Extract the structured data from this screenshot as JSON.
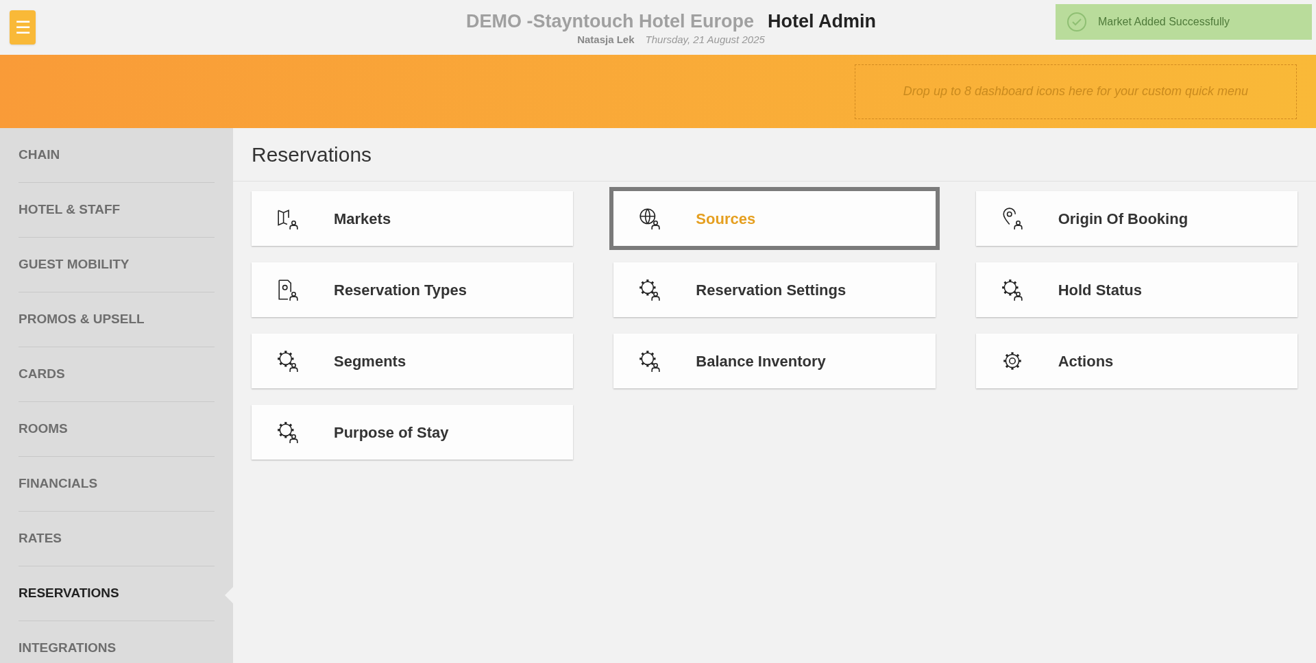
{
  "header": {
    "menu_button": "☰",
    "property": "DEMO -Stayntouch Hotel Europe",
    "app_title": "Hotel Admin",
    "user": "Natasja Lek",
    "date": "Thursday, 21 August 2025"
  },
  "toast": {
    "message": "Market Added Successfully"
  },
  "quick_menu": {
    "placeholder": "Drop up to 8 dashboard icons here for your custom quick menu"
  },
  "sidebar": {
    "items": [
      {
        "label": "CHAIN",
        "selected": false
      },
      {
        "label": "HOTEL & STAFF",
        "selected": false
      },
      {
        "label": "GUEST MOBILITY",
        "selected": false
      },
      {
        "label": "PROMOS & UPSELL",
        "selected": false
      },
      {
        "label": "CARDS",
        "selected": false
      },
      {
        "label": "ROOMS",
        "selected": false
      },
      {
        "label": "FINANCIALS",
        "selected": false
      },
      {
        "label": "RATES",
        "selected": false
      },
      {
        "label": "RESERVATIONS",
        "selected": true
      },
      {
        "label": "INTEGRATIONS",
        "selected": false
      }
    ]
  },
  "content": {
    "title": "Reservations",
    "cards": [
      {
        "label": "Markets",
        "kind": "map",
        "selected": false
      },
      {
        "label": "Sources",
        "kind": "globe",
        "selected": true
      },
      {
        "label": "Origin Of Booking",
        "kind": "pin",
        "selected": false
      },
      {
        "label": "Reservation Types",
        "kind": "document",
        "selected": false
      },
      {
        "label": "Reservation Settings",
        "kind": "gear-person",
        "selected": false
      },
      {
        "label": "Hold Status",
        "kind": "gear-person",
        "selected": false
      },
      {
        "label": "Segments",
        "kind": "gear-person",
        "selected": false
      },
      {
        "label": "Balance Inventory",
        "kind": "gear-person",
        "selected": false
      },
      {
        "label": "Actions",
        "kind": "gear",
        "selected": false
      },
      {
        "label": "Purpose of Stay",
        "kind": "gear-person",
        "selected": false
      }
    ]
  }
}
